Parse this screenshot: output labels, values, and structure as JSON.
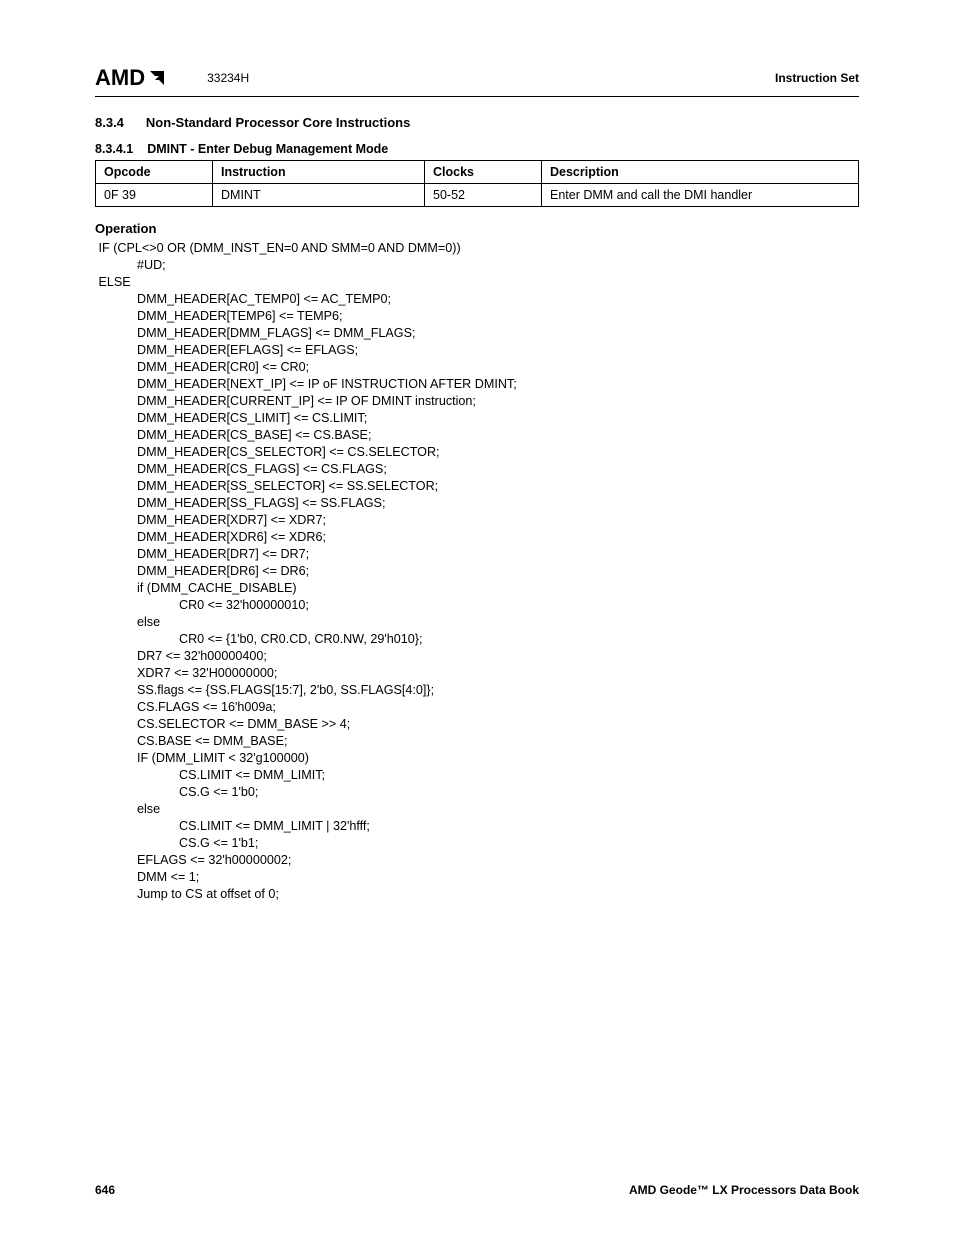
{
  "header": {
    "logo_text": "AMD",
    "docnum": "33234H",
    "right": "Instruction Set"
  },
  "section": {
    "num": "8.3.4",
    "title": "Non-Standard Processor Core Instructions"
  },
  "subsection": {
    "num": "8.3.4.1",
    "title": "DMINT - Enter Debug Management Mode"
  },
  "table": {
    "headers": {
      "c0": "Opcode",
      "c1": "Instruction",
      "c2": "Clocks",
      "c3": "Description"
    },
    "row": {
      "c0": "0F 39",
      "c1": "DMINT",
      "c2": "50-52",
      "c3": "Enter DMM and call the DMI handler"
    }
  },
  "operation_label": "Operation",
  "code_lines": [
    " IF (CPL<>0 OR (DMM_INST_EN=0 AND SMM=0 AND DMM=0))",
    "            #UD;",
    " ELSE",
    "            DMM_HEADER[AC_TEMP0] <= AC_TEMP0;",
    "            DMM_HEADER[TEMP6] <= TEMP6;",
    "            DMM_HEADER[DMM_FLAGS] <= DMM_FLAGS;",
    "            DMM_HEADER[EFLAGS] <= EFLAGS;",
    "            DMM_HEADER[CR0] <= CR0;",
    "            DMM_HEADER[NEXT_IP] <= IP oF INSTRUCTION AFTER DMINT;",
    "            DMM_HEADER[CURRENT_IP] <= IP OF DMINT instruction;",
    "            DMM_HEADER[CS_LIMIT] <= CS.LIMIT;",
    "            DMM_HEADER[CS_BASE] <= CS.BASE;",
    "            DMM_HEADER[CS_SELECTOR] <= CS.SELECTOR;",
    "            DMM_HEADER[CS_FLAGS] <= CS.FLAGS;",
    "            DMM_HEADER[SS_SELECTOR] <= SS.SELECTOR;",
    "            DMM_HEADER[SS_FLAGS] <= SS.FLAGS;",
    "            DMM_HEADER[XDR7] <= XDR7;",
    "            DMM_HEADER[XDR6] <= XDR6;",
    "            DMM_HEADER[DR7] <= DR7;",
    "            DMM_HEADER[DR6] <= DR6;",
    "            if (DMM_CACHE_DISABLE)",
    "                        CR0 <= 32'h00000010;",
    "            else",
    "                        CR0 <= {1'b0, CR0.CD, CR0.NW, 29'h010};",
    "            DR7 <= 32'h00000400;",
    "            XDR7 <= 32'H00000000;",
    "            SS.flags <= {SS.FLAGS[15:7], 2'b0, SS.FLAGS[4:0]};",
    "            CS.FLAGS <= 16'h009a;",
    "            CS.SELECTOR <= DMM_BASE >> 4;",
    "            CS.BASE <= DMM_BASE;",
    "            IF (DMM_LIMIT < 32'g100000)",
    "                        CS.LIMIT <= DMM_LIMIT;",
    "                        CS.G <= 1'b0;",
    "            else",
    "                        CS.LIMIT <= DMM_LIMIT | 32'hfff;",
    "                        CS.G <= 1'b1;",
    "            EFLAGS <= 32'h00000002;",
    "            DMM <= 1;",
    "            Jump to CS at offset of 0;"
  ],
  "footer": {
    "page": "646",
    "book": "AMD Geode™ LX Processors Data Book"
  }
}
